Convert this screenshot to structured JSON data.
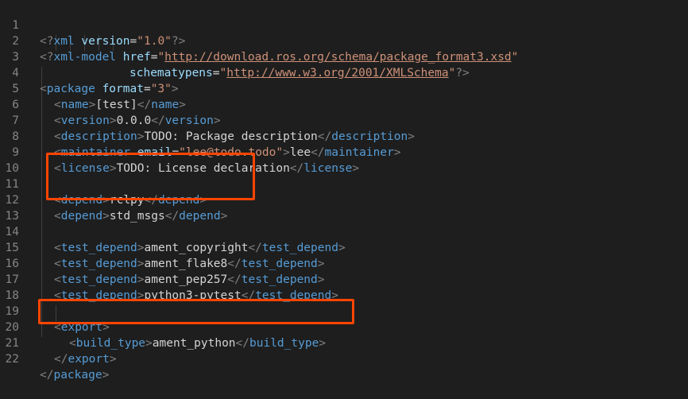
{
  "line_numbers": [
    "1",
    "2",
    "3",
    "4",
    "5",
    "6",
    "7",
    "8",
    "9",
    "10",
    "11",
    "12",
    "13",
    "14",
    "15",
    "16",
    "17",
    "18",
    "19",
    "20",
    "21",
    "22"
  ],
  "lines": {
    "l1": {
      "open": "<?",
      "name": "xml",
      "attr": "version",
      "eq": "=",
      "value": "\"1.0\"",
      "close": "?>"
    },
    "l2": {
      "open": "<?",
      "name": "xml-model",
      "attr": "href",
      "eq": "=",
      "q1": "\"",
      "url": "http://download.ros.org/schema/package_format3.xsd",
      "q2": "\""
    },
    "l3": {
      "attr": "schematypens",
      "eq": "=",
      "q1": "\"",
      "url": "http://www.w3.org/2001/XMLSchema",
      "q2": "\"",
      "close": "?>"
    },
    "l4": {
      "open": "<",
      "name": "package",
      "attr": "format",
      "eq": "=",
      "value": "\"3\"",
      "close": ">"
    },
    "l5": {
      "open": "<",
      "tag": "name",
      "close": ">",
      "text": "[test]",
      "open2": "</",
      "tag2": "name",
      "close2": ">"
    },
    "l6": {
      "open": "<",
      "tag": "version",
      "close": ">",
      "text": "0.0.0",
      "open2": "</",
      "tag2": "version",
      "close2": ">"
    },
    "l7": {
      "open": "<",
      "tag": "description",
      "close": ">",
      "text": "TODO: Package description",
      "open2": "</",
      "tag2": "description",
      "close2": ">"
    },
    "l8": {
      "open": "<",
      "tag": "maintainer",
      "attr": "email",
      "eq": "=",
      "value": "\"lee@todo.todo\"",
      "close": ">",
      "text": "lee",
      "open2": "</",
      "tag2": "maintainer",
      "close2": ">"
    },
    "l9": {
      "open": "<",
      "tag": "license",
      "close": ">",
      "text": "TODO: License declaration",
      "open2": "</",
      "tag2": "license",
      "close2": ">"
    },
    "l11": {
      "open": "<",
      "tag": "depend",
      "close": ">",
      "text": "rclpy",
      "open2": "</",
      "tag2": "depend",
      "close2": ">"
    },
    "l12": {
      "open": "<",
      "tag": "depend",
      "close": ">",
      "text": "std_msgs",
      "open2": "</",
      "tag2": "depend",
      "close2": ">"
    },
    "l14": {
      "open": "<",
      "tag": "test_depend",
      "close": ">",
      "text": "ament_copyright",
      "open2": "</",
      "tag2": "test_depend",
      "close2": ">"
    },
    "l15": {
      "open": "<",
      "tag": "test_depend",
      "close": ">",
      "text": "ament_flake8",
      "open2": "</",
      "tag2": "test_depend",
      "close2": ">"
    },
    "l16": {
      "open": "<",
      "tag": "test_depend",
      "close": ">",
      "text": "ament_pep257",
      "open2": "</",
      "tag2": "test_depend",
      "close2": ">"
    },
    "l17": {
      "open": "<",
      "tag": "test_depend",
      "close": ">",
      "text": "python3-pytest",
      "open2": "</",
      "tag2": "test_depend",
      "close2": ">"
    },
    "l19": {
      "open": "<",
      "tag": "export",
      "close": ">"
    },
    "l20": {
      "open": "<",
      "tag": "build_type",
      "close": ">",
      "text": "ament_python",
      "open2": "</",
      "tag2": "build_type",
      "close2": ">"
    },
    "l21": {
      "open": "</",
      "tag": "export",
      "close": ">"
    },
    "l22": {
      "open": "</",
      "tag": "package",
      "close": ">"
    }
  },
  "theme": {
    "background": "#1e1e1e",
    "line_number": "#858585",
    "tag": "#569cd6",
    "punctuation": "#808080",
    "attribute": "#9cdcfe",
    "string": "#ce9178",
    "text": "#d4d4d4",
    "highlight_box": "#ff4500"
  }
}
